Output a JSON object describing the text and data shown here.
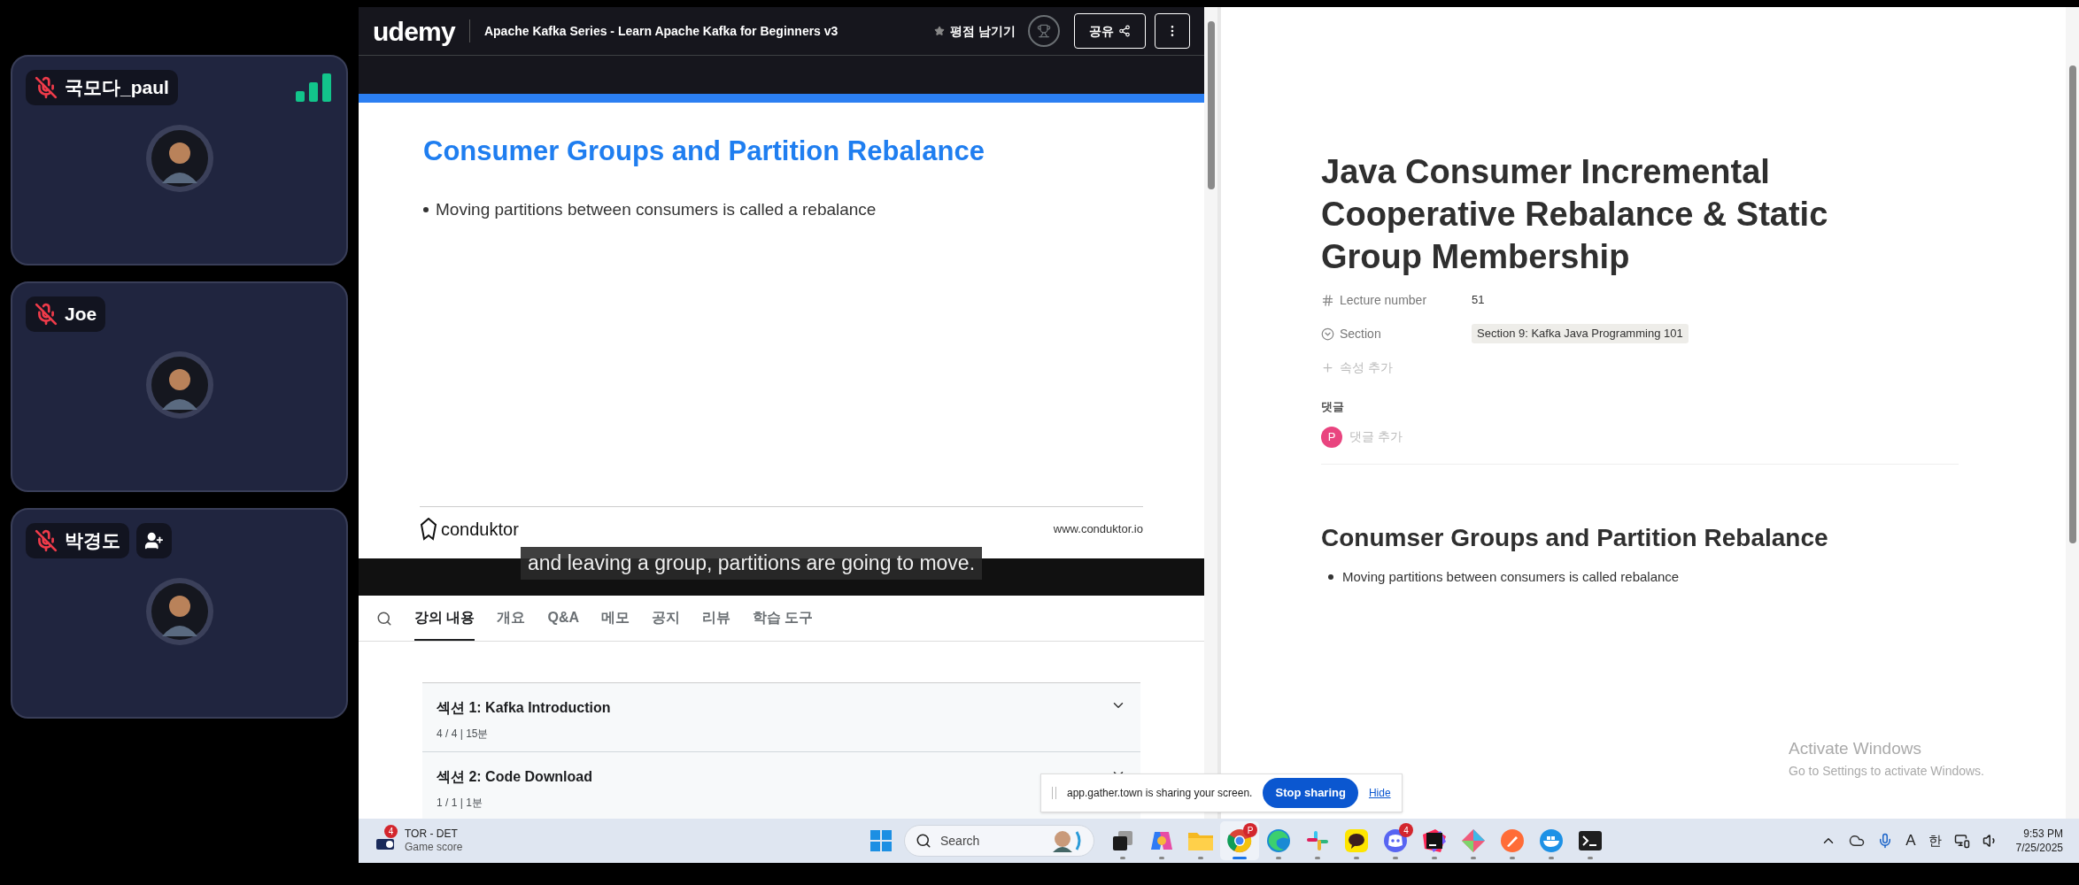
{
  "participants": [
    {
      "name": "국모다_paul",
      "muted": true,
      "kind": "self"
    },
    {
      "name": "Joe",
      "muted": true,
      "kind": "member"
    },
    {
      "name": "박경도",
      "muted": true,
      "kind": "guest"
    }
  ],
  "course_player": {
    "logo": "udemy",
    "course_title": "Apache Kafka Series - Learn Apache Kafka for Beginners v3",
    "rate_label": "평점 남기기",
    "share_label": "공유",
    "slide": {
      "title": "Consumer Groups and Partition Rebalance",
      "bullets": [
        "Moving partitions between consumers is called a rebalance"
      ],
      "brand": "conduktor",
      "url": "www.conduktor.io"
    },
    "caption": "and leaving a group, partitions are going to move.",
    "tabs": [
      {
        "label": "강의 내용",
        "selected": true
      },
      {
        "label": "개요",
        "selected": false
      },
      {
        "label": "Q&A",
        "selected": false
      },
      {
        "label": "메모",
        "selected": false
      },
      {
        "label": "공지",
        "selected": false
      },
      {
        "label": "리뷰",
        "selected": false
      },
      {
        "label": "학습 도구",
        "selected": false
      }
    ],
    "sections": [
      {
        "title": "섹션 1: Kafka Introduction",
        "meta": "4 / 4 | 15분"
      },
      {
        "title": "섹션 2: Code Download",
        "meta": "1 / 1 | 1분"
      }
    ]
  },
  "notes_page": {
    "title": "Java Consumer Incremental Cooperative Rebalance & Static Group Membership",
    "properties": [
      {
        "kind": "number",
        "label": "Lecture number",
        "value": "51"
      },
      {
        "kind": "select",
        "label": "Section",
        "value": "Section 9: Kafka Java Programming 101"
      }
    ],
    "add_property": "속성 추가",
    "comments_heading": "댓글",
    "comment_avatar": "P",
    "comment_placeholder": "댓글 추가",
    "heading": "Conumser Groups and Partition Rebalance",
    "bullets": [
      "Moving partitions between consumers is called rebalance"
    ]
  },
  "share_bar": {
    "message": "app.gather.town is sharing your screen.",
    "stop_label": "Stop sharing",
    "hide_label": "Hide"
  },
  "activation_notice": {
    "title": "Activate Windows",
    "subtitle": "Go to Settings to activate Windows."
  },
  "taskbar": {
    "widget": {
      "badge": "4",
      "title": "TOR - DET",
      "subtitle": "Game score"
    },
    "search_placeholder": "Search",
    "apps": [
      {
        "kind": "task-view",
        "selected": false
      },
      {
        "kind": "copilot",
        "selected": false
      },
      {
        "kind": "files",
        "selected": false
      },
      {
        "kind": "chrome",
        "selected": true,
        "badge": "P"
      },
      {
        "kind": "edge",
        "selected": false
      },
      {
        "kind": "slack",
        "selected": false
      },
      {
        "kind": "kakao",
        "selected": false
      },
      {
        "kind": "discord",
        "selected": false,
        "badge": "4"
      },
      {
        "kind": "intellij",
        "selected": false
      },
      {
        "kind": "git",
        "selected": false
      },
      {
        "kind": "postman",
        "selected": false
      },
      {
        "kind": "docker",
        "selected": false
      },
      {
        "kind": "terminal",
        "selected": false
      }
    ],
    "input_mode": "A",
    "ime": "한",
    "time": "9:53 PM",
    "date": "7/25/2025"
  }
}
